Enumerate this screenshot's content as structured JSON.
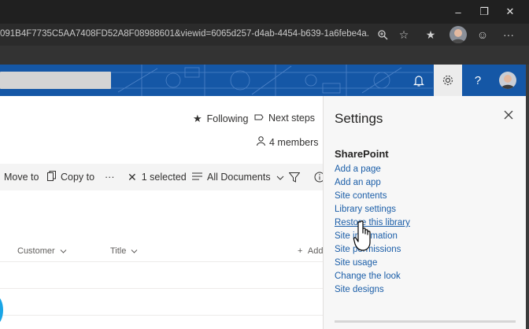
{
  "browser": {
    "url": "091B4F7735C5AA7408FD52A8F08988601&viewid=6065d257-d4ab-4454-b639-1a6febe4a..."
  },
  "page": {
    "following_label": "Following",
    "next_steps_label": "Next steps",
    "members_label": "4 members"
  },
  "commandbar": {
    "move_to": "Move to",
    "copy_to": "Copy to",
    "more": "···",
    "selected": "1 selected",
    "view": "All Documents"
  },
  "list": {
    "columns": [
      "Customer",
      "Title"
    ],
    "add_column": "Add"
  },
  "settings": {
    "title": "Settings",
    "section": "SharePoint",
    "links": [
      "Add a page",
      "Add an app",
      "Site contents",
      "Library settings",
      "Restore this library",
      "Site information",
      "Site permissions",
      "Site usage",
      "Change the look",
      "Site designs"
    ]
  },
  "icons": {
    "star": "star-icon",
    "next_steps": "flag-icon",
    "members": "person-icon",
    "copy": "copy-icon",
    "close_selection": "close-icon",
    "view": "list-icon",
    "filter": "filter-icon",
    "info": "info-icon",
    "bell": "bell-icon",
    "gear": "gear-icon",
    "help": "help-icon",
    "cursor": "hand-pointer-icon"
  },
  "colors": {
    "suitebar": "#1557a6",
    "link": "#1b5ea8",
    "accent": "#0078d4"
  }
}
